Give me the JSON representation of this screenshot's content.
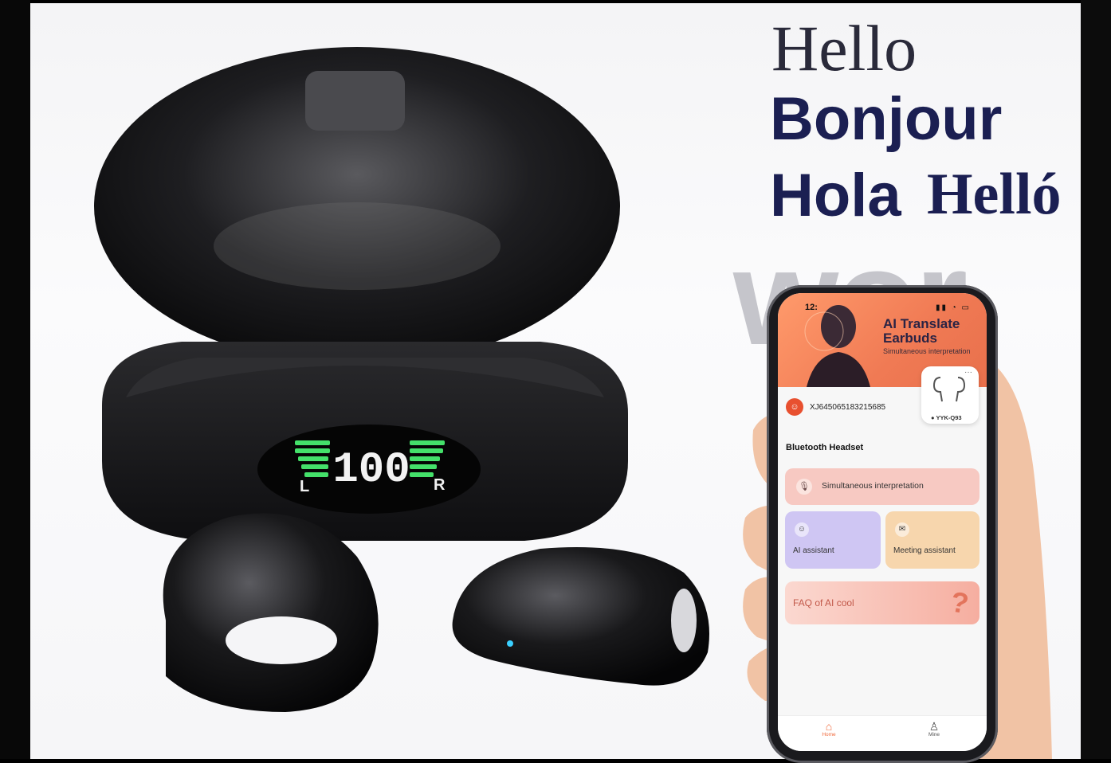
{
  "greetings": {
    "hello": "Hello",
    "bonjour": "Bonjour",
    "hola": "Hola",
    "hello_hu": "Helló",
    "watermark": "wor"
  },
  "case_display": {
    "battery": "100",
    "left_label": "L",
    "right_label": "R"
  },
  "phone": {
    "status_time": "12:",
    "app_title": "AI Translate Earbuds",
    "app_subtitle": "Simultaneous interpretation",
    "device_model": "YYK-Q93",
    "user_id": "XJ645065183215685",
    "section_title": "Bluetooth Headset",
    "tiles": {
      "interpretation": "Simultaneous interpretation",
      "ai_assistant": "AI assistant",
      "meeting_assistant": "Meeting assistant",
      "faq": "FAQ of AI cool"
    },
    "tabs": {
      "home": "Home",
      "mine": "Mine"
    },
    "accent_color": "#f07a54"
  }
}
